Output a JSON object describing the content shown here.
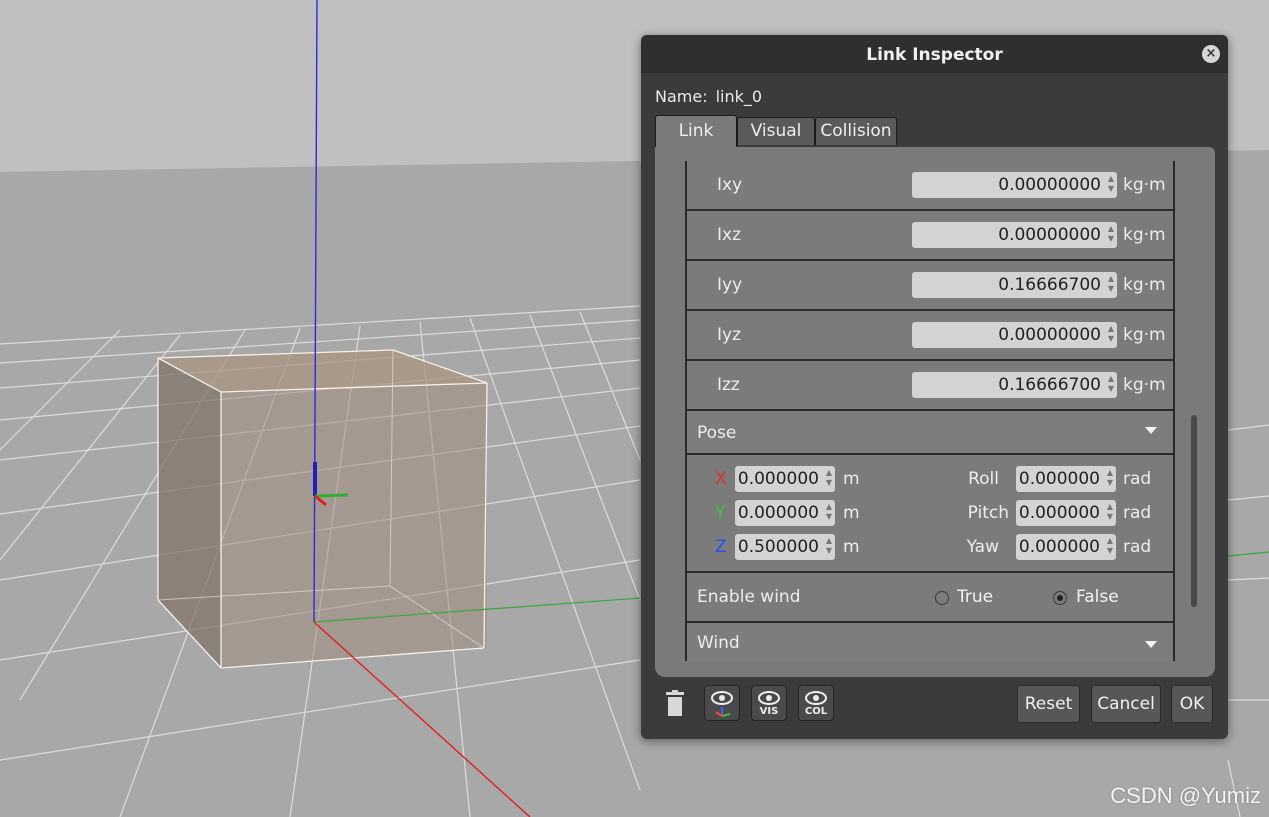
{
  "watermark": "CSDN @Yumiz",
  "dialog": {
    "title": "Link Inspector",
    "name_label": "Name:",
    "name_value": "link_0",
    "tabs": [
      {
        "label": "Link",
        "active": true
      },
      {
        "label": "Visual",
        "active": false
      },
      {
        "label": "Collision",
        "active": false
      }
    ],
    "inertia": [
      {
        "label": "Ixy",
        "value": "0.00000000",
        "unit": "kg·m"
      },
      {
        "label": "Ixz",
        "value": "0.00000000",
        "unit": "kg·m"
      },
      {
        "label": "Iyy",
        "value": "0.16666700",
        "unit": "kg·m"
      },
      {
        "label": "Iyz",
        "value": "0.00000000",
        "unit": "kg·m"
      },
      {
        "label": "Izz",
        "value": "0.16666700",
        "unit": "kg·m"
      }
    ],
    "pose": {
      "label": "Pose",
      "x": {
        "label": "X",
        "value": "0.000000",
        "unit": "m",
        "color": "#e03030"
      },
      "y": {
        "label": "Y",
        "value": "0.000000",
        "unit": "m",
        "color": "#3cc43c"
      },
      "z": {
        "label": "Z",
        "value": "0.500000",
        "unit": "m",
        "color": "#2a4df0"
      },
      "roll": {
        "label": "Roll",
        "value": "0.000000",
        "unit": "rad"
      },
      "pitch": {
        "label": "Pitch",
        "value": "0.000000",
        "unit": "rad"
      },
      "yaw": {
        "label": "Yaw",
        "value": "0.000000",
        "unit": "rad"
      }
    },
    "enable_wind": {
      "label": "Enable wind",
      "true_label": "True",
      "false_label": "False",
      "selected": "False"
    },
    "wind_section": {
      "label": "Wind"
    },
    "footer": {
      "icons": [
        "trash-icon",
        "eye-axes-icon",
        "eye-visual-icon",
        "eye-collision-icon"
      ],
      "vis_label": "VIS",
      "col_label": "COL",
      "reset_label": "Reset",
      "cancel_label": "Cancel",
      "ok_label": "OK"
    }
  }
}
